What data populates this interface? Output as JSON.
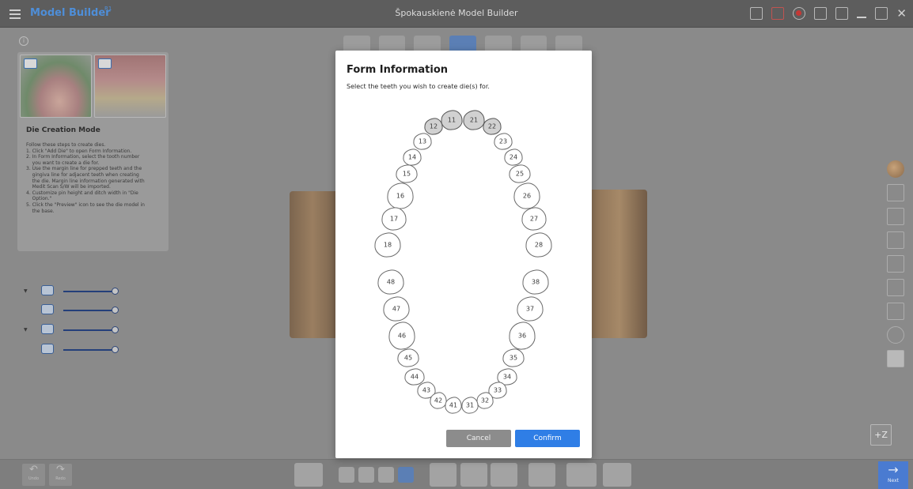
{
  "titlebar": {
    "app_name": "Model Builder",
    "app_badge": "R1",
    "window_title": "Špokauskienė Model Builder"
  },
  "info_icon": "i",
  "left_panel": {
    "title": "Die Creation Mode",
    "body": "Follow these steps to create dies.\n1. Click \"Add Die\" to open Form Information.\n2. In Form Information, select the tooth number\n    you want to create a die for.\n3. Use the margin line for prepped teeth and the\n    gingiva line for adjacent teeth when creating\n    the die. Margin line information generated with\n    Medit Scan S/W will be imported.\n4. Customize pin height and ditch width in \"Die\n    Option.\"\n5. Click the \"Preview\" icon to see the die model in\n    the base."
  },
  "sliders": [
    {
      "level": 1.0
    },
    {
      "level": 1.0
    },
    {
      "level": 1.0
    },
    {
      "level": 1.0
    }
  ],
  "modal": {
    "title": "Form Information",
    "subtitle": "Select the teeth you wish to create die(s) for.",
    "cancel_label": "Cancel",
    "confirm_label": "Confirm",
    "teeth": [
      {
        "number": "11",
        "selected": true
      },
      {
        "number": "21",
        "selected": true
      },
      {
        "number": "12",
        "selected": true
      },
      {
        "number": "22",
        "selected": true
      },
      {
        "number": "13",
        "selected": false
      },
      {
        "number": "23",
        "selected": false
      },
      {
        "number": "14",
        "selected": false
      },
      {
        "number": "24",
        "selected": false
      },
      {
        "number": "15",
        "selected": false
      },
      {
        "number": "25",
        "selected": false
      },
      {
        "number": "16",
        "selected": false
      },
      {
        "number": "26",
        "selected": false
      },
      {
        "number": "17",
        "selected": false
      },
      {
        "number": "27",
        "selected": false
      },
      {
        "number": "18",
        "selected": false
      },
      {
        "number": "28",
        "selected": false
      },
      {
        "number": "48",
        "selected": false
      },
      {
        "number": "38",
        "selected": false
      },
      {
        "number": "47",
        "selected": false
      },
      {
        "number": "37",
        "selected": false
      },
      {
        "number": "46",
        "selected": false
      },
      {
        "number": "36",
        "selected": false
      },
      {
        "number": "45",
        "selected": false
      },
      {
        "number": "35",
        "selected": false
      },
      {
        "number": "44",
        "selected": false
      },
      {
        "number": "34",
        "selected": false
      },
      {
        "number": "43",
        "selected": false
      },
      {
        "number": "33",
        "selected": false
      },
      {
        "number": "42",
        "selected": false
      },
      {
        "number": "32",
        "selected": false
      },
      {
        "number": "41",
        "selected": false
      },
      {
        "number": "31",
        "selected": false
      }
    ]
  },
  "bottom_bar": {
    "undo_label": "Undo",
    "redo_label": "Redo",
    "next_label": "Next"
  },
  "z_button": "+Z",
  "colors": {
    "accent": "#2f7ee6",
    "app_name": "#4e8ed8",
    "record": "#e0302c",
    "selected_tooth": "#d1d1d1"
  }
}
